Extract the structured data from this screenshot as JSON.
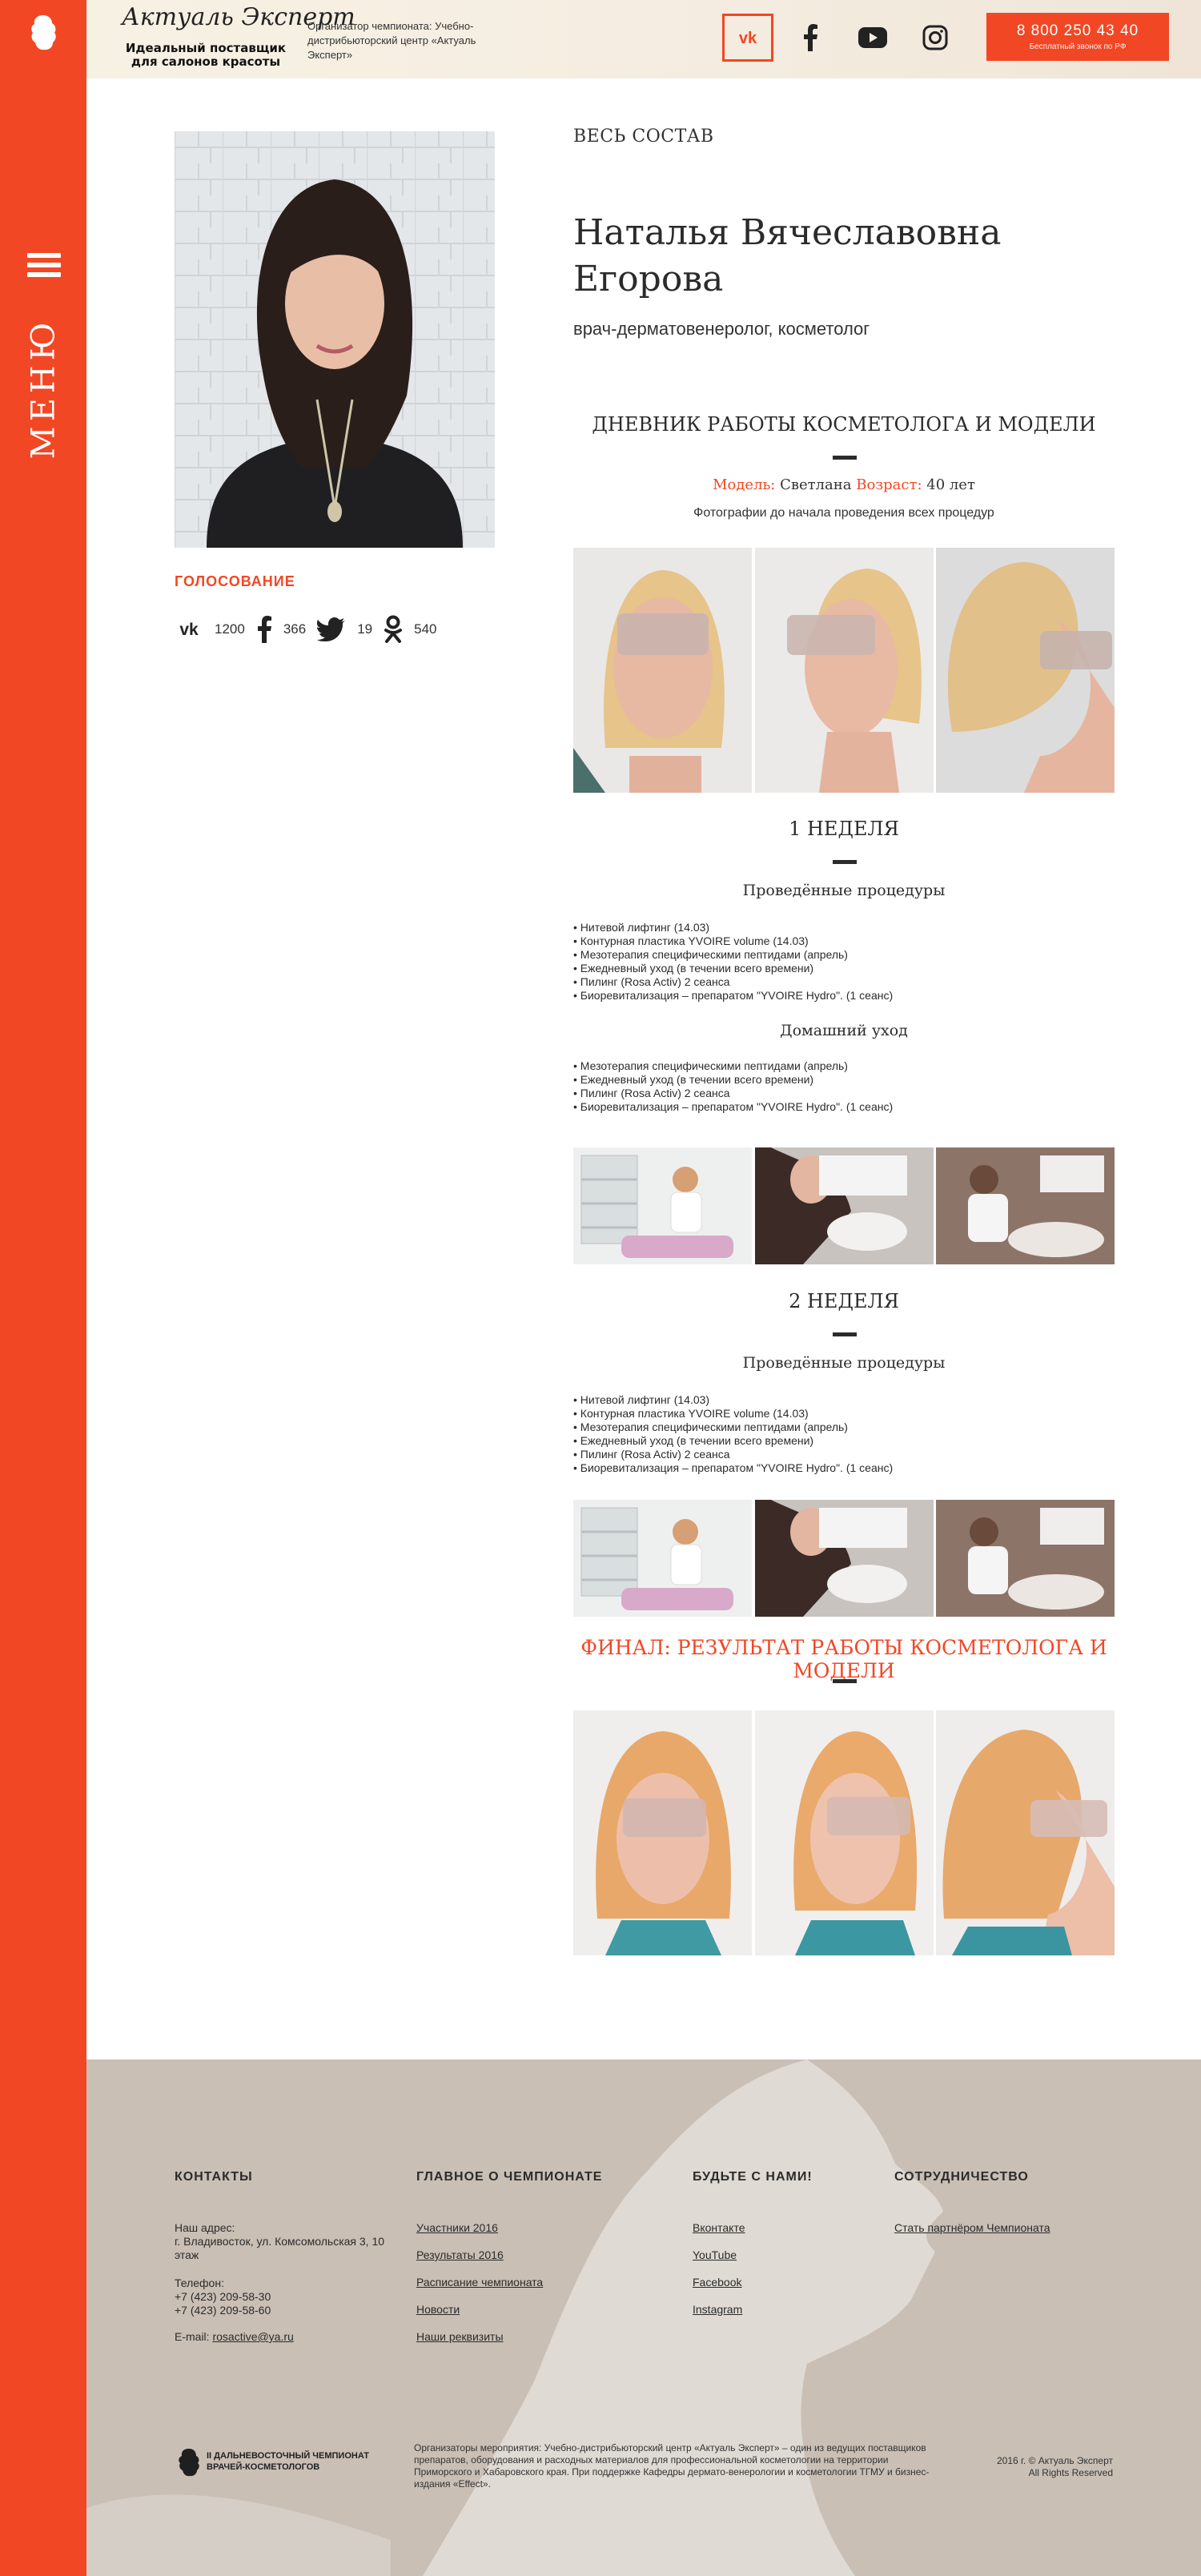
{
  "menu": {
    "label": "МЕНЮ"
  },
  "header": {
    "brand_script": "Актуаль Эксперт",
    "brand_tagline": "Идеальный поставщик для салонов красоты",
    "organizer": "Организатор чемпионата: Учебно-дистрибьюторский центр «Актуаль Эксперт»",
    "social": [
      "vk-icon",
      "facebook-icon",
      "youtube-icon",
      "instagram-icon"
    ],
    "phone": "8 800 250 43 40",
    "phone_note": "Бесплатный звонок по РФ"
  },
  "profile": {
    "back_link": "ВЕСЬ СОСТАВ",
    "name_line1": "Наталья Вячеславовна",
    "name_line2": "Егорова",
    "role": "врач-дерматовенеролог, косметолог"
  },
  "voting": {
    "title": "ГОЛОСОВАНИЕ",
    "shares": [
      {
        "network": "vk",
        "count": "1200"
      },
      {
        "network": "facebook",
        "count": "366"
      },
      {
        "network": "twitter",
        "count": "19"
      },
      {
        "network": "odnoklassniki",
        "count": "540"
      }
    ]
  },
  "diary": {
    "title": "ДНЕВНИК РАБОТЫ КОСМЕТОЛОГА И МОДЕЛИ",
    "model_label": "Модель:",
    "model_name": "Светлана",
    "age_label": "Возраст:",
    "age_value": "40 лет",
    "before_caption": "Фотографии до начала проведения всех процедур",
    "weeks": [
      {
        "title": "1 НЕДЕЛЯ",
        "procedures_title": "Проведённые процедуры",
        "procedures": [
          "Нитевой лифтинг (14.03)",
          "Контурная пластика YVOIRE volume (14.03)",
          "Мезотерапия специфическими пептидами (апрель)",
          "Ежедневный уход (в течении всего времени)",
          "Пилинг (Rosa Activ) 2 сеанса",
          "Биоревитализация – препаратом \"YVOIRE Hydro\". (1 сеанс)"
        ],
        "home_title": "Домашний уход",
        "home": [
          "Мезотерапия специфическими пептидами (апрель)",
          "Ежедневный уход (в течении всего времени)",
          "Пилинг (Rosa Activ) 2 сеанса",
          "Биоревитализация – препаратом \"YVOIRE Hydro\". (1 сеанс)"
        ]
      },
      {
        "title": "2 НЕДЕЛЯ",
        "procedures_title": "Проведённые процедуры",
        "procedures": [
          "Нитевой лифтинг (14.03)",
          "Контурная пластика YVOIRE volume (14.03)",
          "Мезотерапия специфическими пептидами (апрель)",
          "Ежедневный уход (в течении всего времени)",
          "Пилинг (Rosa Activ) 2 сеанса",
          "Биоревитализация – препаратом \"YVOIRE Hydro\". (1 сеанс)"
        ]
      }
    ],
    "final_title": "ФИНАЛ: РЕЗУЛЬТАТ РАБОТЫ КОСМЕТОЛОГА И МОДЕЛИ"
  },
  "footer": {
    "contacts": {
      "title": "КОНТАКТЫ",
      "address_label": "Наш адрес:",
      "address": "г. Владивосток, ул. Комсомольская 3, 10 этаж",
      "phone_label": "Телефон:",
      "phone1": "+7 (423) 209-58-30",
      "phone2": "+7 (423) 209-58-60",
      "email_label": "E-mail:",
      "email": "rosactive@ya.ru"
    },
    "main": {
      "title": "ГЛАВНОЕ О ЧЕМПИОНАТЕ",
      "links": [
        "Участники 2016",
        "Результаты 2016",
        "Расписание чемпионата",
        "Новости",
        "Наши реквизиты"
      ]
    },
    "social": {
      "title": "БУДЬТЕ С НАМИ!",
      "links": [
        "Вконтакте",
        "YouTube",
        "Facebook",
        "Instagram"
      ]
    },
    "partners": {
      "title": "СОТРУДНИЧЕСТВО",
      "link": "Стать партнёром Чемпионата"
    },
    "logo_text1": "II ДАЛЬНЕВОСТОЧНЫЙ ЧЕМПИОНАТ",
    "logo_text2": "ВРАЧЕЙ-КОСМЕТОЛОГОВ",
    "about": "Организаторы мероприятия: Учебно-дистрибьюторский центр «Актуаль Эксперт» – один из ведущих поставщиков препаратов, оборудования и расходных материалов для профессиональной косметологии на территории Приморского и Хабаровского края. При поддержке Кафедры дермато-венерологии и косметологии ТГМУ и бизнес-издания «Effect».",
    "copyright": "2016 г. © Актуаль Эксперт",
    "rights": "All Rights Reserved"
  },
  "colors": {
    "accent": "#f24724",
    "footer_bg": "#c9bfb5",
    "header_bg": "#f6efe2"
  }
}
